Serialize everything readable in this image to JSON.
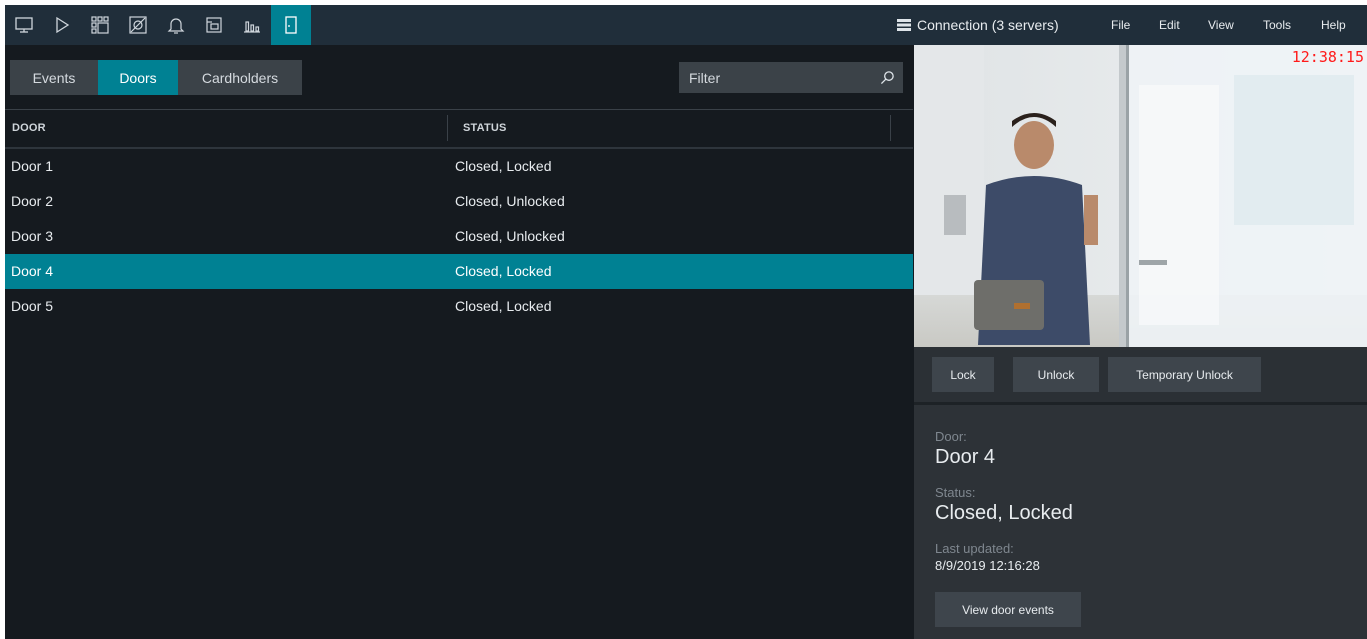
{
  "toolbar": {
    "icons": [
      "monitor-icon",
      "play-icon",
      "layout-grid-icon",
      "search-camera-icon",
      "bell-icon",
      "archive-icon",
      "chart-icon",
      "door-icon"
    ],
    "active_index": 7,
    "connection_label": "Connection (3 servers)",
    "menu": [
      "File",
      "Edit",
      "View",
      "Tools",
      "Help"
    ],
    "accent": "#008193"
  },
  "tabs": [
    {
      "label": "Events",
      "active": false
    },
    {
      "label": "Doors",
      "active": true
    },
    {
      "label": "Cardholders",
      "active": false
    }
  ],
  "filter": {
    "placeholder": "Filter",
    "value": ""
  },
  "table": {
    "columns": [
      "DOOR",
      "STATUS"
    ],
    "rows": [
      {
        "door": "Door 1",
        "status": "Closed, Locked",
        "selected": false
      },
      {
        "door": "Door 2",
        "status": "Closed, Unlocked",
        "selected": false
      },
      {
        "door": "Door 3",
        "status": "Closed, Unlocked",
        "selected": false
      },
      {
        "door": "Door 4",
        "status": "Closed, Locked",
        "selected": true
      },
      {
        "door": "Door 5",
        "status": "Closed, Locked",
        "selected": false
      }
    ]
  },
  "camera": {
    "time": "12:38:15"
  },
  "actions": {
    "lock": "Lock",
    "unlock": "Unlock",
    "temp_unlock": "Temporary Unlock"
  },
  "details": {
    "door_label": "Door:",
    "door_value": "Door 4",
    "status_label": "Status:",
    "status_value": "Closed, Locked",
    "updated_label": "Last updated:",
    "updated_value": "8/9/2019 12:16:28",
    "view_events": "View door events"
  }
}
